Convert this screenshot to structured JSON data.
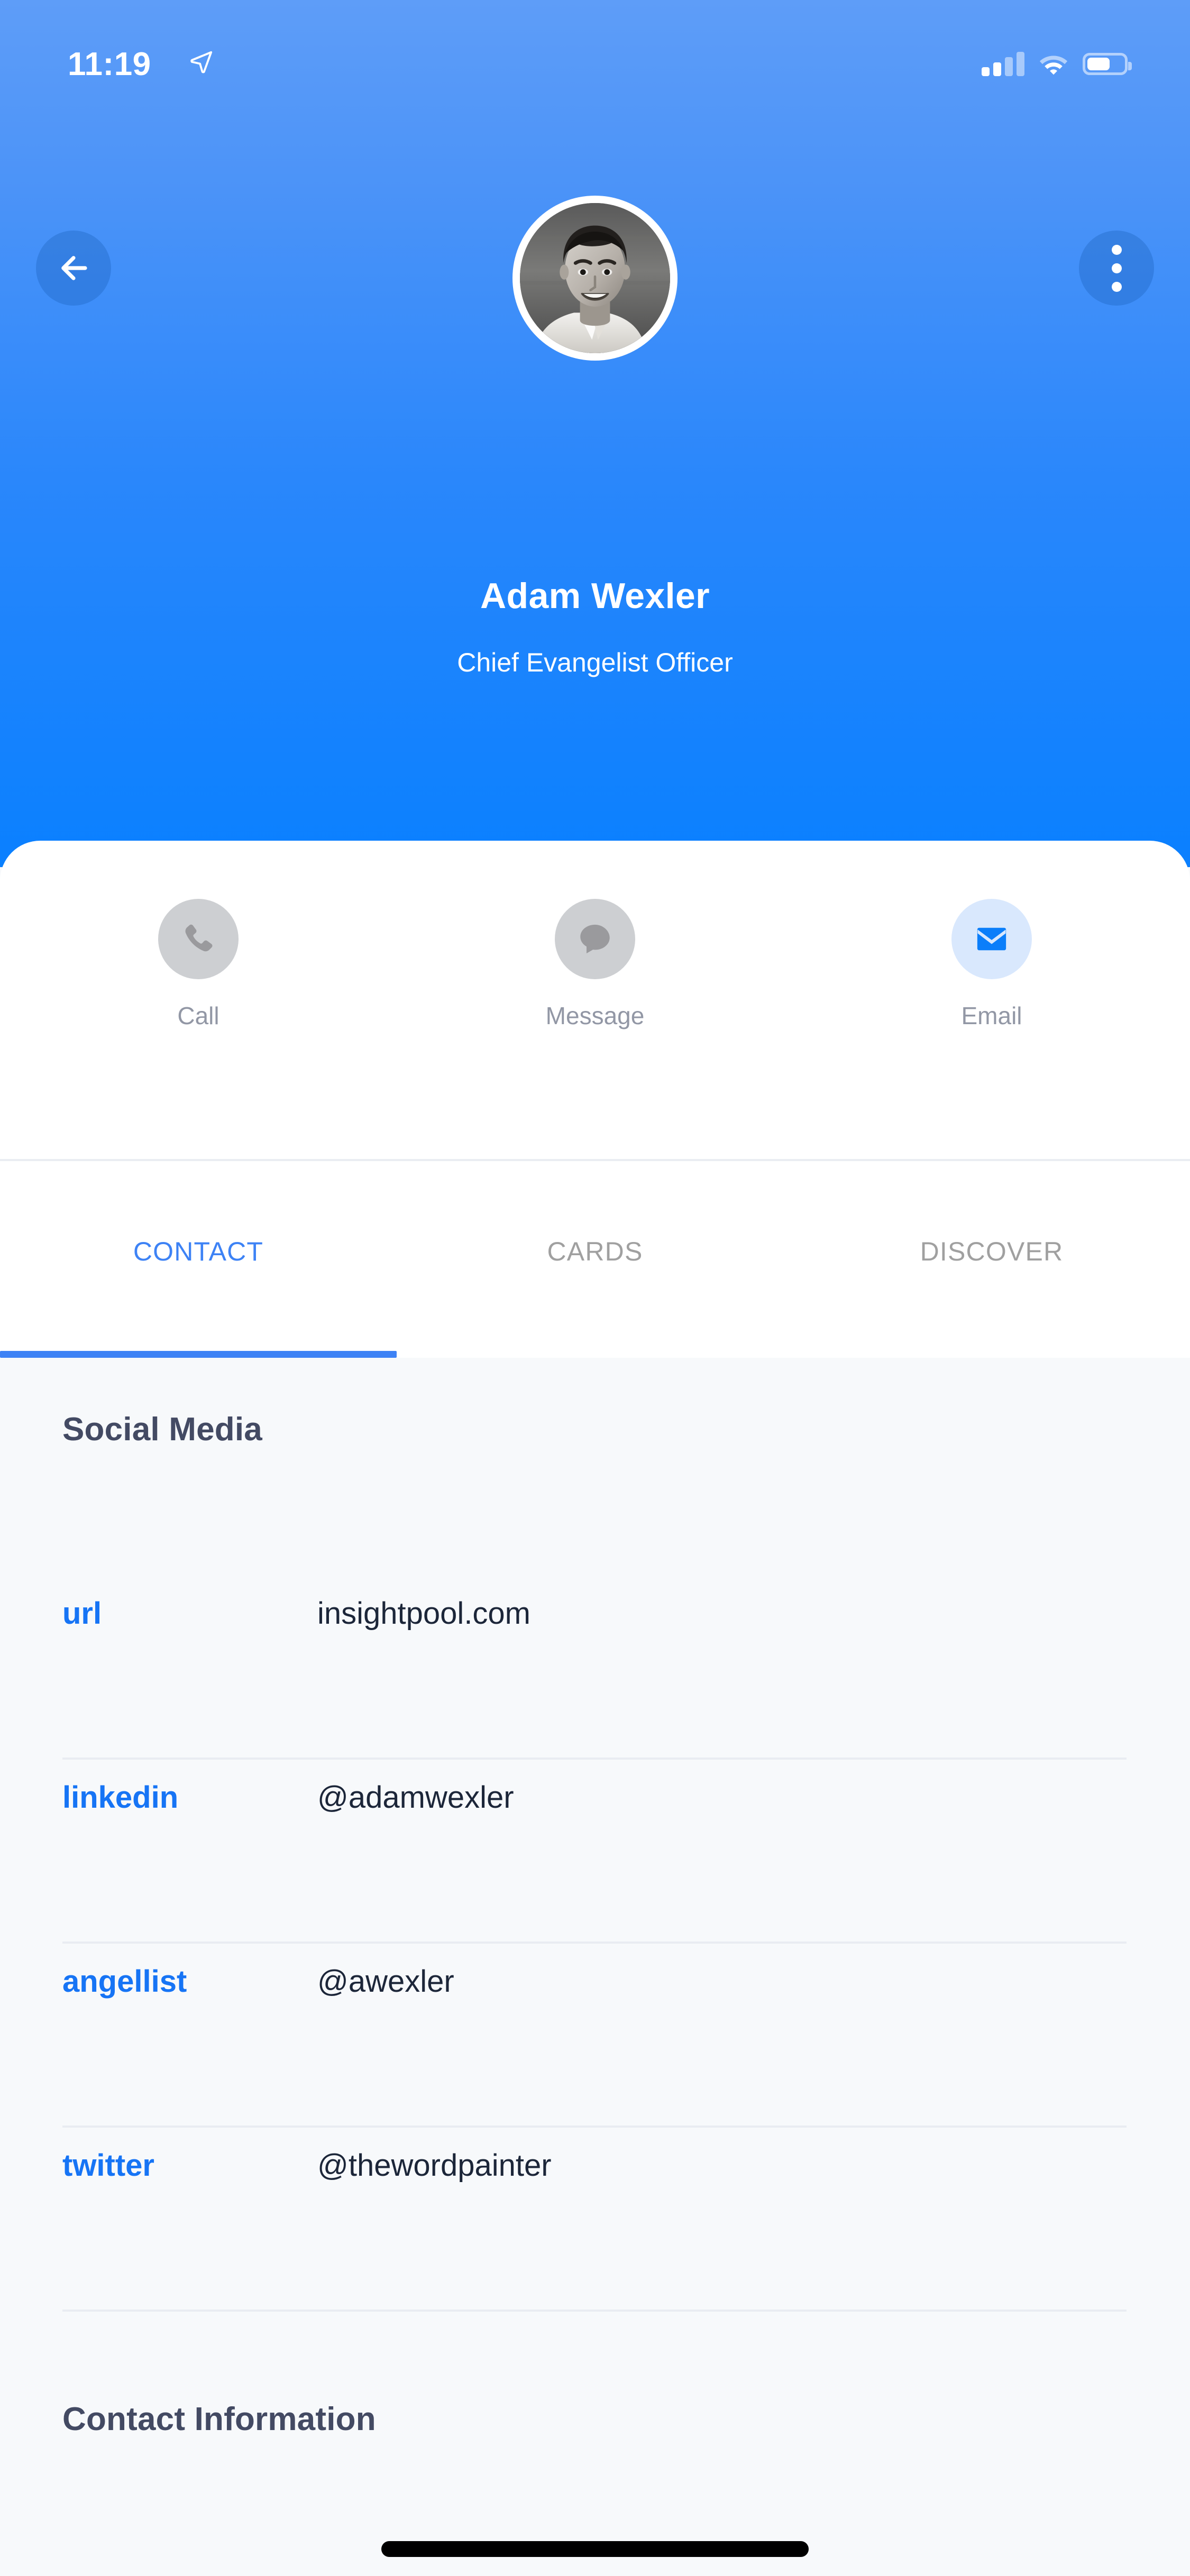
{
  "status_bar": {
    "time": "11:19",
    "location_icon": "location-arrow-icon",
    "signal_icon": "cellular-signal-icon",
    "wifi_icon": "wifi-icon",
    "battery_icon": "battery-icon",
    "battery_level_percent": 63
  },
  "header": {
    "back_icon": "arrow-left-icon",
    "more_icon": "more-vertical-icon",
    "avatar_name": "avatar",
    "name": "Adam Wexler",
    "title": "Chief Evangelist Officer",
    "gradient_top": "#5e9df8",
    "gradient_bottom": "#0a80ff"
  },
  "actions": [
    {
      "label": "Call",
      "icon": "phone-icon",
      "active": false
    },
    {
      "label": "Message",
      "icon": "chat-bubble-icon",
      "active": false
    },
    {
      "label": "Email",
      "icon": "envelope-icon",
      "active": true
    }
  ],
  "tabs": [
    {
      "label": "CONTACT",
      "active": true
    },
    {
      "label": "CARDS",
      "active": false
    },
    {
      "label": "DISCOVER",
      "active": false
    }
  ],
  "sections": {
    "social_media_heading": "Social Media",
    "contact_information_heading": "Contact Information"
  },
  "social_media": [
    {
      "label": "url",
      "value": "insightpool.com"
    },
    {
      "label": "linkedin",
      "value": "@adamwexler"
    },
    {
      "label": "angellist",
      "value": "@awexler"
    },
    {
      "label": "twitter",
      "value": "@thewordpainter"
    }
  ],
  "colors": {
    "accent_blue": "#1674f5",
    "tab_active": "#3d82f5",
    "heading": "#434a63",
    "value_text": "#1c2639",
    "muted": "#9297a5",
    "icon_gray_circle": "#cdcfd2",
    "icon_blue_circle": "#d9e8fd"
  },
  "home_indicator": "home-indicator"
}
